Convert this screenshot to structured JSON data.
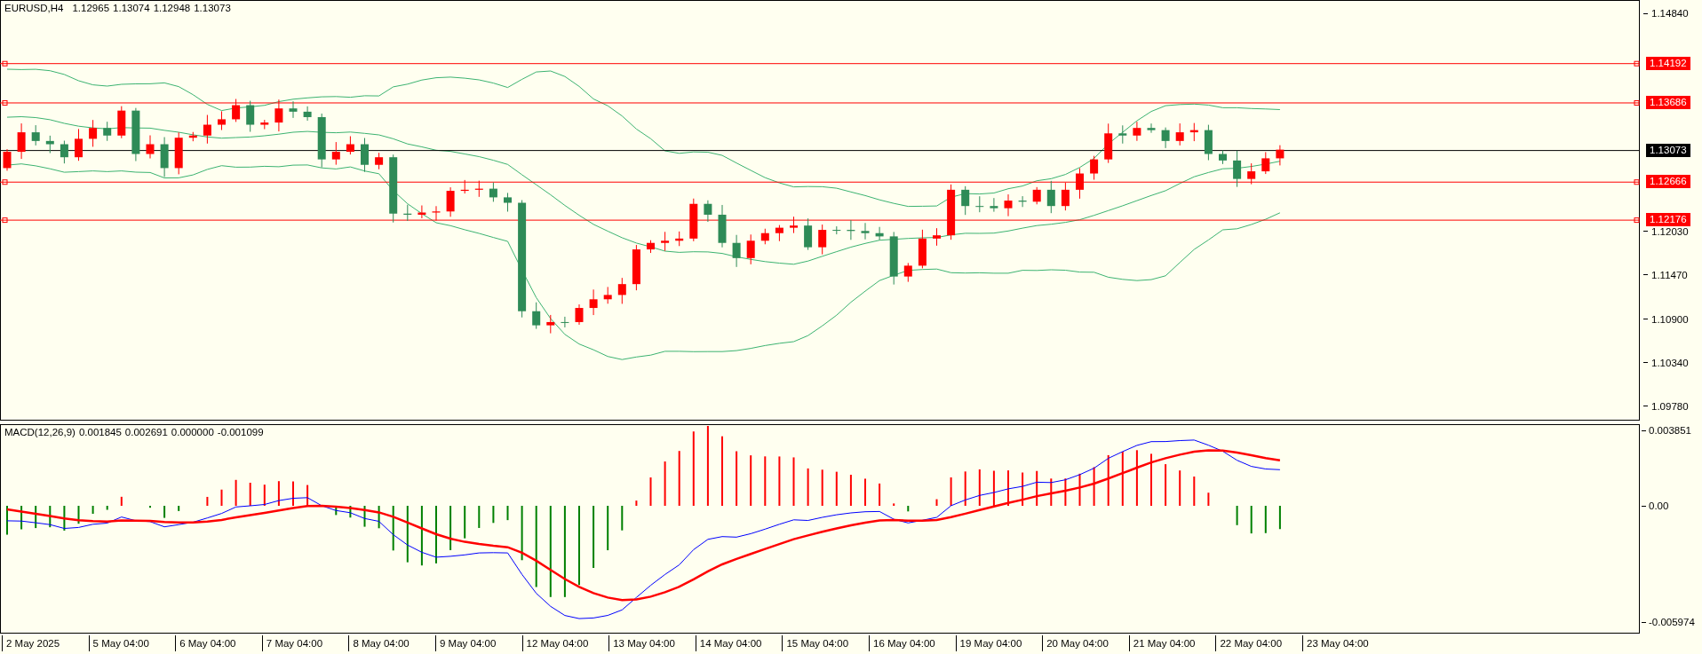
{
  "chart": {
    "symbol": "EURUSD,H4",
    "ohlc": [
      "1.12965",
      "1.13074",
      "1.12948",
      "1.13073"
    ]
  },
  "price_axis": {
    "ticks": [
      "1.14840",
      "1.12030",
      "1.11470",
      "1.10900",
      "1.10340",
      "1.09780"
    ]
  },
  "price_lines": [
    {
      "kind": "level",
      "label": "1.14192",
      "color": "#ff0000"
    },
    {
      "kind": "level",
      "label": "1.13686",
      "color": "#ff0000"
    },
    {
      "kind": "bid",
      "label": "1.13073",
      "color": "#000000"
    },
    {
      "kind": "level",
      "label": "1.12666",
      "color": "#ff0000"
    },
    {
      "kind": "level",
      "label": "1.12176",
      "color": "#ff0000"
    }
  ],
  "macd": {
    "title": "MACD(12,26,9)",
    "values": [
      "0.001845",
      "0.002691",
      "0.000000",
      "-0.001099"
    ],
    "ticks": [
      "0.003851",
      "0.00",
      "-0.005974"
    ]
  },
  "time_axis": {
    "labels": [
      "2 May 2025",
      "5 May 04:00",
      "6 May 04:00",
      "7 May 04:00",
      "8 May 04:00",
      "9 May 04:00",
      "12 May 04:00",
      "13 May 04:00",
      "14 May 04:00",
      "15 May 04:00",
      "16 May 04:00",
      "19 May 04:00",
      "20 May 04:00",
      "21 May 04:00",
      "22 May 04:00",
      "23 May 04:00"
    ]
  }
}
